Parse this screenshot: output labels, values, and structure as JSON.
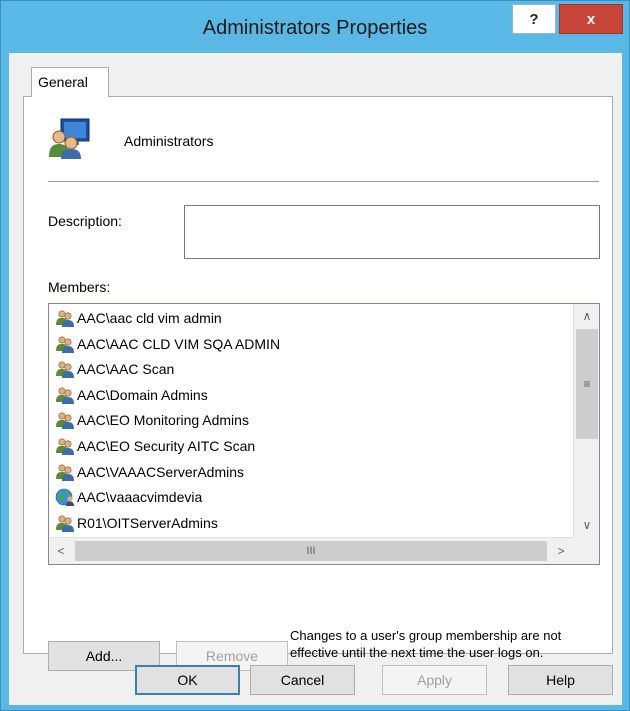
{
  "window": {
    "title": "Administrators Properties",
    "help_label": "?",
    "close_label": "x"
  },
  "tabs": [
    {
      "label": "General"
    }
  ],
  "general": {
    "group_name": "Administrators",
    "description_label": "Description:",
    "description_value": "",
    "members_label": "Members:",
    "members": [
      {
        "name": "AAC\\aac cld vim admin",
        "icon": "group-icon"
      },
      {
        "name": "AAC\\AAC CLD VIM SQA ADMIN",
        "icon": "group-icon"
      },
      {
        "name": "AAC\\AAC Scan",
        "icon": "group-icon"
      },
      {
        "name": "AAC\\Domain Admins",
        "icon": "group-icon"
      },
      {
        "name": "AAC\\EO Monitoring Admins",
        "icon": "group-icon"
      },
      {
        "name": "AAC\\EO Security AITC Scan",
        "icon": "group-icon"
      },
      {
        "name": "AAC\\VAAACServerAdmins",
        "icon": "group-icon"
      },
      {
        "name": "AAC\\vaaacvimdevia",
        "icon": "user-globe-icon"
      },
      {
        "name": "R01\\OITServerAdmins",
        "icon": "group-icon"
      }
    ],
    "add_label": "Add...",
    "remove_label": "Remove",
    "note": "Changes to a user's group membership are not effective until the next time the user logs on."
  },
  "footer": {
    "ok_label": "OK",
    "cancel_label": "Cancel",
    "apply_label": "Apply",
    "help_label": "Help"
  },
  "colors": {
    "frame": "#5ab8e6",
    "close_button": "#c8453a",
    "default_button_border": "#3c7fb1"
  }
}
